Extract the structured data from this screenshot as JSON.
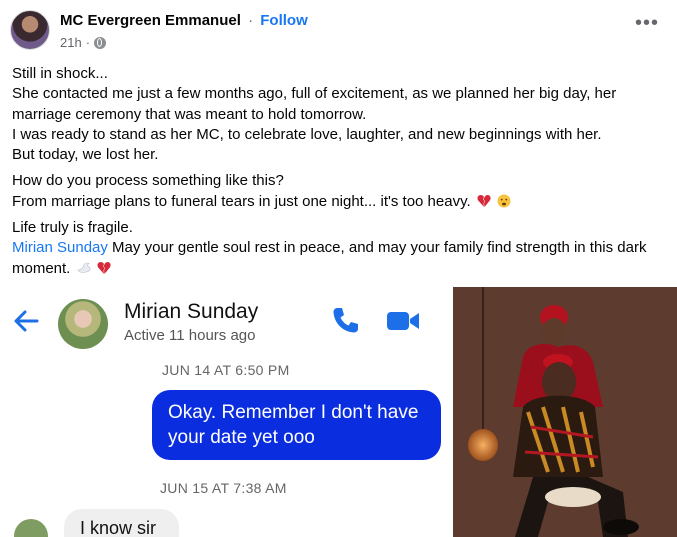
{
  "post": {
    "author": "MC Evergreen Emmanuel",
    "separator": "·",
    "follow_label": "Follow",
    "time": "21h",
    "privacy_icon": "globe-icon",
    "more_icon": "more-options-icon"
  },
  "content": {
    "p1": [
      "Still in shock...",
      "She contacted me just a few months ago, full of excitement, as we planned her big day, her",
      "marriage ceremony that was meant to hold tomorrow.",
      "I was ready to stand as her MC, to celebrate love, laughter, and new beginnings with her.",
      "But today, we lost her."
    ],
    "p2": [
      "How do you process something like this?",
      "From marriage plans to funeral tears in just one night... it's too heavy."
    ],
    "p3_line1": "Life truly is fragile.",
    "mention": "Mirian Sunday",
    "p3_line2_rest": " May your gentle soul rest in peace, and may your family find strength in this dark",
    "p3_line3": "moment.",
    "colors": {
      "link": "#1877f2",
      "bubble": "#0a2de0"
    }
  },
  "chat": {
    "name": "Mirian Sunday",
    "status": "Active 11 hours ago",
    "stamp1": "JUN 14 AT 6:50 PM",
    "message1_line1": "Okay. Remember I don't have",
    "message1_line2": "your date yet ooo",
    "stamp2": "JUN 15 AT 7:38 AM",
    "message2": "I know sir"
  }
}
